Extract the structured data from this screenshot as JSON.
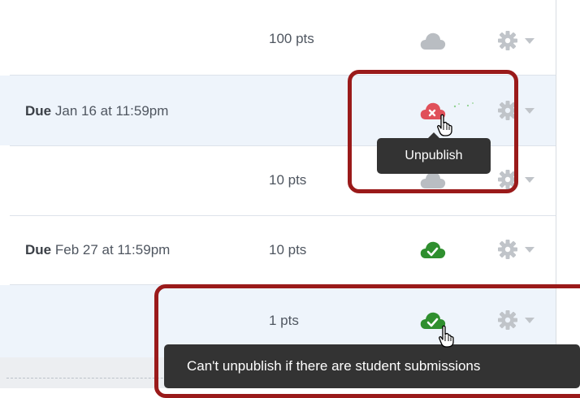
{
  "assignments": [
    {
      "due_label": "",
      "due_date": "",
      "points": "100 pts",
      "publish_state": "unpublished-gray-cloud",
      "action_icon": "gear-icon"
    },
    {
      "due_label": "Due",
      "due_date": "Jan 16 at 11:59pm",
      "points": "",
      "publish_state": "unpublish-hover-red-cloud",
      "action_icon": "gear-icon"
    },
    {
      "due_label": "",
      "due_date": "",
      "points": "10 pts",
      "publish_state": "hidden-under-tooltip",
      "action_icon": "gear-icon"
    },
    {
      "due_label": "Due",
      "due_date": "Feb 27 at 11:59pm",
      "points": "10 pts",
      "publish_state": "published-green-check",
      "action_icon": "gear-icon"
    },
    {
      "due_label": "",
      "due_date": "",
      "points": "1 pts",
      "publish_state": "published-green-check-hover",
      "action_icon": "gear-icon"
    }
  ],
  "tooltips": {
    "unpublish": "Unpublish",
    "cant_unpublish": "Can't unpublish if there are student submissions"
  },
  "colors": {
    "published_green": "#2f8f2f",
    "unpublish_red": "#e0505a",
    "unpublished_gray": "#b9bdc2",
    "gear_gray": "#c0c4c9",
    "highlight_red": "#9a1a1a",
    "tooltip_bg": "#333333",
    "row_highlight": "#eef4fb"
  }
}
